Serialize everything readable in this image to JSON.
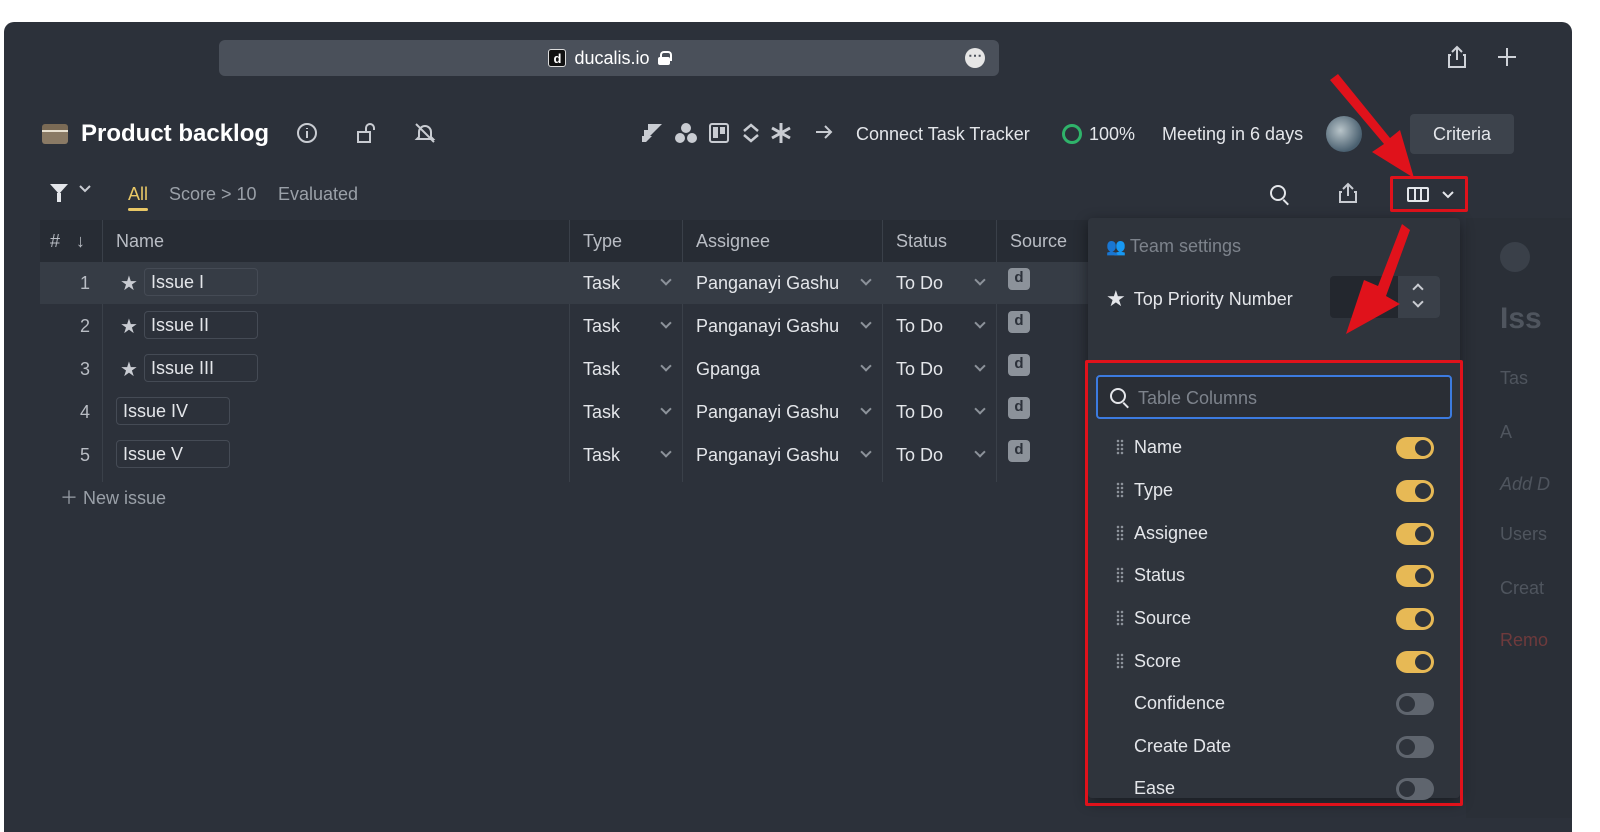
{
  "browser": {
    "url": "ducalis.io",
    "favicon_letter": "d",
    "more_icon": "⋯"
  },
  "header": {
    "title": "Product backlog",
    "connect_label": "Connect Task Tracker",
    "progress": "100%",
    "meeting": "Meeting in 6 days",
    "criteria_label": "Criteria"
  },
  "filters": {
    "tabs": [
      "All",
      "Score > 10",
      "Evaluated"
    ],
    "active": "All"
  },
  "table": {
    "headers": {
      "num": "#",
      "sort": "↓",
      "name": "Name",
      "type": "Type",
      "assignee": "Assignee",
      "status": "Status",
      "source": "Source"
    },
    "rows": [
      {
        "num": "1",
        "starred": true,
        "name": "Issue I",
        "type": "Task",
        "assignee": "Panganayi Gashu",
        "status": "To Do",
        "source": "d"
      },
      {
        "num": "2",
        "starred": true,
        "name": "Issue II",
        "type": "Task",
        "assignee": "Panganayi Gashu",
        "status": "To Do",
        "source": "d"
      },
      {
        "num": "3",
        "starred": true,
        "name": "Issue III",
        "type": "Task",
        "assignee": "Gpanga",
        "status": "To Do",
        "source": "d"
      },
      {
        "num": "4",
        "starred": false,
        "name": "Issue IV",
        "type": "Task",
        "assignee": "Panganayi Gashu",
        "status": "To Do",
        "source": "d"
      },
      {
        "num": "5",
        "starred": false,
        "name": "Issue V",
        "type": "Task",
        "assignee": "Panganayi Gashu",
        "status": "To Do",
        "source": "d"
      }
    ],
    "new_issue_label": "New issue"
  },
  "column_panel": {
    "team_settings": "Team settings",
    "top_priority": "Top Priority Number",
    "search_placeholder": "Table Columns",
    "columns": [
      {
        "label": "Name",
        "enabled": true,
        "draggable": true
      },
      {
        "label": "Type",
        "enabled": true,
        "draggable": true
      },
      {
        "label": "Assignee",
        "enabled": true,
        "draggable": true
      },
      {
        "label": "Status",
        "enabled": true,
        "draggable": true
      },
      {
        "label": "Source",
        "enabled": true,
        "draggable": true
      },
      {
        "label": "Score",
        "enabled": true,
        "draggable": true
      },
      {
        "label": "Confidence",
        "enabled": false,
        "draggable": false
      },
      {
        "label": "Create Date",
        "enabled": false,
        "draggable": false
      },
      {
        "label": "Ease",
        "enabled": false,
        "draggable": false
      }
    ]
  },
  "ghost_panel": {
    "title": "Iss",
    "type": "Tas",
    "add": "A",
    "add_desc": "Add D",
    "users": "Users",
    "created": "Creat",
    "remove": "Remo"
  },
  "colors": {
    "accent": "#e8c766",
    "toggle_on": "#e7b955",
    "highlight_red": "#e0121b",
    "progress_green": "#2fb36a",
    "focus_blue": "#3c7be0"
  }
}
